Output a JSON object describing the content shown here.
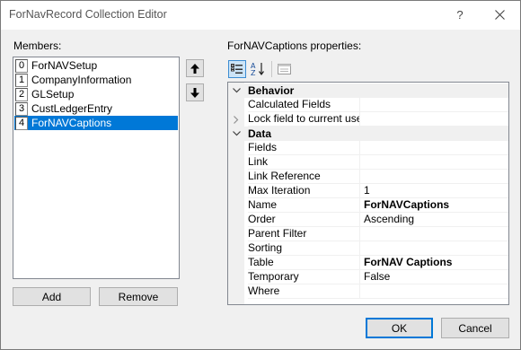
{
  "window": {
    "title": "ForNavRecord Collection Editor"
  },
  "members": {
    "label": "Members:",
    "items": [
      {
        "index": "0",
        "name": "ForNAVSetup"
      },
      {
        "index": "1",
        "name": "CompanyInformation"
      },
      {
        "index": "2",
        "name": "GLSetup"
      },
      {
        "index": "3",
        "name": "CustLedgerEntry"
      },
      {
        "index": "4",
        "name": "ForNAVCaptions",
        "selected": true
      }
    ],
    "add_label": "Add",
    "remove_label": "Remove"
  },
  "properties": {
    "label": "ForNAVCaptions properties:",
    "categories": [
      {
        "name": "Behavior",
        "rows": [
          {
            "name": "Calculated Fields",
            "value": ""
          },
          {
            "name": "Lock field to current user cu",
            "value": "",
            "expandable": true
          }
        ]
      },
      {
        "name": "Data",
        "rows": [
          {
            "name": "Fields",
            "value": ""
          },
          {
            "name": "Link",
            "value": ""
          },
          {
            "name": "Link Reference",
            "value": ""
          },
          {
            "name": "Max Iteration",
            "value": "1"
          },
          {
            "name": "Name",
            "value": "ForNAVCaptions",
            "bold": true
          },
          {
            "name": "Order",
            "value": "Ascending"
          },
          {
            "name": "Parent Filter",
            "value": ""
          },
          {
            "name": "Sorting",
            "value": ""
          },
          {
            "name": "Table",
            "value": "ForNAV Captions",
            "bold": true
          },
          {
            "name": "Temporary",
            "value": "False"
          },
          {
            "name": "Where",
            "value": ""
          }
        ]
      }
    ]
  },
  "footer": {
    "ok_label": "OK",
    "cancel_label": "Cancel"
  },
  "icons": {
    "move_up": "arrow-up-icon",
    "move_down": "arrow-down-icon",
    "categorized": "categorized-icon",
    "alphabetical": "sort-alphabetical-icon",
    "property_pages": "property-pages-icon",
    "help": "help-icon",
    "close": "close-icon"
  },
  "colors": {
    "selection": "#0078d7",
    "accent_border": "#0078d7",
    "grid_line": "#f0f0f0"
  }
}
